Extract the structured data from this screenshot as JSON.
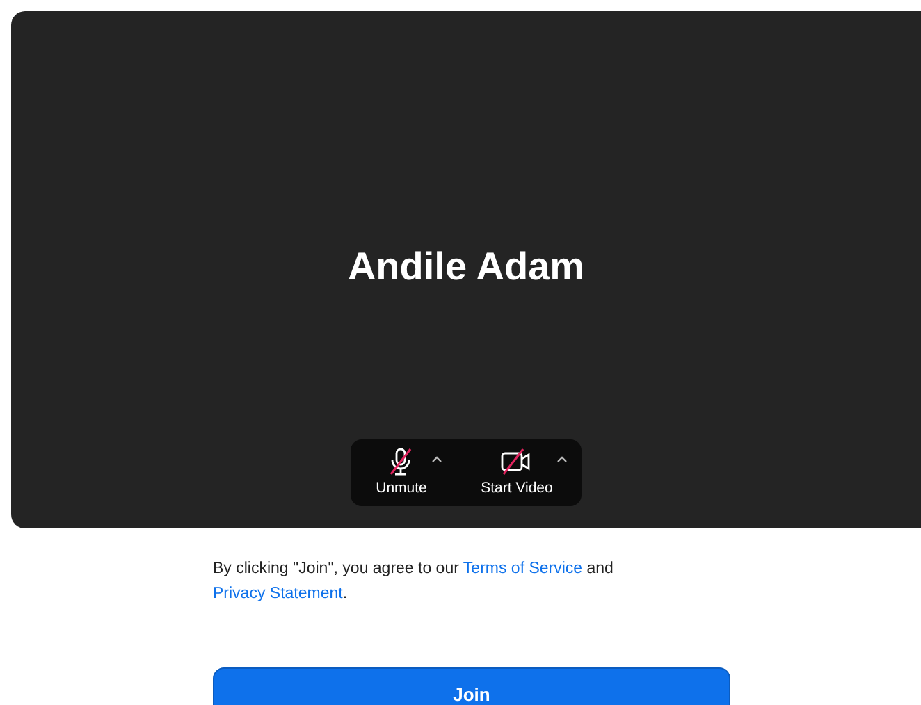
{
  "preview": {
    "name": "Andile Adam"
  },
  "controls": [
    {
      "kind": "audio",
      "label": "Unmute",
      "muted": true
    },
    {
      "kind": "video",
      "label": "Start Video",
      "muted": true
    }
  ],
  "agreement": {
    "before": "By clicking \"Join\", you agree to our ",
    "link_1": "Terms of Service",
    "middle": " and",
    "link_2": "Privacy Statement",
    "after": "."
  },
  "join_button": "Join"
}
